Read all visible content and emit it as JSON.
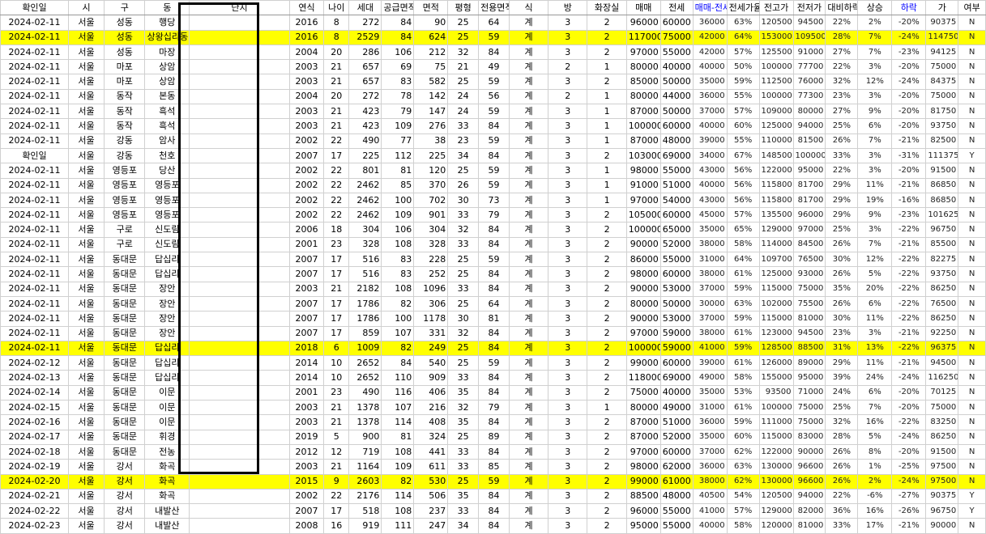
{
  "columns": [
    {
      "label": "확인일",
      "w": 80
    },
    {
      "label": "시",
      "w": 42
    },
    {
      "label": "구",
      "w": 48
    },
    {
      "label": "동",
      "w": 52
    },
    {
      "label": "단지",
      "w": 118
    },
    {
      "label": "연식",
      "w": 40
    },
    {
      "label": "나이",
      "w": 30
    },
    {
      "label": "세대",
      "w": 38
    },
    {
      "label": "공급면적",
      "w": 38
    },
    {
      "label": "면적",
      "w": 40
    },
    {
      "label": "평형",
      "w": 36
    },
    {
      "label": "전용면적",
      "w": 36
    },
    {
      "label": "식",
      "w": 46
    },
    {
      "label": "방",
      "w": 46
    },
    {
      "label": "화장실",
      "w": 46
    },
    {
      "label": "매매",
      "w": 40
    },
    {
      "label": "전세",
      "w": 38
    },
    {
      "label": "매매-전세",
      "w": 40,
      "blue": true
    },
    {
      "label": "전세가율",
      "w": 38
    },
    {
      "label": "전고가",
      "w": 40
    },
    {
      "label": "전저가",
      "w": 38
    },
    {
      "label": "대비하락",
      "w": 38
    },
    {
      "label": "상승",
      "w": 40
    },
    {
      "label": "하락",
      "w": 40,
      "blue": true
    },
    {
      "label": "가",
      "w": 38
    },
    {
      "label": "여부",
      "w": 32
    }
  ],
  "rows": [
    {
      "hl": false,
      "c": [
        "2024-02-11",
        "서울",
        "성동",
        "행당",
        "",
        "2016",
        "8",
        "272",
        "84",
        "90",
        "25",
        "64",
        "계",
        "3",
        "2",
        "96000",
        "60000",
        "36000",
        "63%",
        "120500",
        "94500",
        "22%",
        "2%",
        "-20%",
        "90375",
        "N"
      ]
    },
    {
      "hl": true,
      "c": [
        "2024-02-11",
        "서울",
        "성동",
        "상왕십리동",
        "",
        "2016",
        "8",
        "2529",
        "84",
        "624",
        "25",
        "59",
        "계",
        "3",
        "2",
        "117000",
        "75000",
        "42000",
        "64%",
        "153000",
        "109500",
        "28%",
        "7%",
        "-24%",
        "114750",
        "N"
      ]
    },
    {
      "hl": false,
      "c": [
        "2024-02-11",
        "서울",
        "성동",
        "마장",
        "",
        "2004",
        "20",
        "286",
        "106",
        "212",
        "32",
        "84",
        "계",
        "3",
        "2",
        "97000",
        "55000",
        "42000",
        "57%",
        "125500",
        "91000",
        "27%",
        "7%",
        "-23%",
        "94125",
        "N"
      ]
    },
    {
      "hl": false,
      "c": [
        "2024-02-11",
        "서울",
        "마포",
        "상암",
        "",
        "2003",
        "21",
        "657",
        "69",
        "75",
        "21",
        "49",
        "계",
        "2",
        "1",
        "80000",
        "40000",
        "40000",
        "50%",
        "100000",
        "77700",
        "22%",
        "3%",
        "-20%",
        "75000",
        "N"
      ]
    },
    {
      "hl": false,
      "c": [
        "2024-02-11",
        "서울",
        "마포",
        "상암",
        "",
        "2003",
        "21",
        "657",
        "83",
        "582",
        "25",
        "59",
        "계",
        "3",
        "2",
        "85000",
        "50000",
        "35000",
        "59%",
        "112500",
        "76000",
        "32%",
        "12%",
        "-24%",
        "84375",
        "N"
      ]
    },
    {
      "hl": false,
      "c": [
        "2024-02-11",
        "서울",
        "동작",
        "본동",
        "",
        "2004",
        "20",
        "272",
        "78",
        "142",
        "24",
        "56",
        "계",
        "2",
        "1",
        "80000",
        "44000",
        "36000",
        "55%",
        "100000",
        "77300",
        "23%",
        "3%",
        "-20%",
        "75000",
        "N"
      ]
    },
    {
      "hl": false,
      "c": [
        "2024-02-11",
        "서울",
        "동작",
        "흑석",
        "",
        "2003",
        "21",
        "423",
        "79",
        "147",
        "24",
        "59",
        "계",
        "3",
        "1",
        "87000",
        "50000",
        "37000",
        "57%",
        "109000",
        "80000",
        "27%",
        "9%",
        "-20%",
        "81750",
        "N"
      ]
    },
    {
      "hl": false,
      "c": [
        "2024-02-11",
        "서울",
        "동작",
        "흑석",
        "",
        "2003",
        "21",
        "423",
        "109",
        "276",
        "33",
        "84",
        "계",
        "3",
        "1",
        "100000",
        "60000",
        "40000",
        "60%",
        "125000",
        "94000",
        "25%",
        "6%",
        "-20%",
        "93750",
        "N"
      ]
    },
    {
      "hl": false,
      "c": [
        "2024-02-11",
        "서울",
        "강동",
        "암사",
        "",
        "2002",
        "22",
        "490",
        "77",
        "38",
        "23",
        "59",
        "계",
        "3",
        "1",
        "87000",
        "48000",
        "39000",
        "55%",
        "110000",
        "81500",
        "26%",
        "7%",
        "-21%",
        "82500",
        "N"
      ]
    },
    {
      "hl": false,
      "c": [
        "확인일",
        "서울",
        "강동",
        "천호",
        "",
        "2007",
        "17",
        "225",
        "112",
        "225",
        "34",
        "84",
        "계",
        "3",
        "2",
        "103000",
        "69000",
        "34000",
        "67%",
        "148500",
        "100000",
        "33%",
        "3%",
        "-31%",
        "111375",
        "Y"
      ]
    },
    {
      "hl": false,
      "c": [
        "2024-02-11",
        "서울",
        "영등포",
        "당산",
        "",
        "2002",
        "22",
        "801",
        "81",
        "120",
        "25",
        "59",
        "계",
        "3",
        "1",
        "98000",
        "55000",
        "43000",
        "56%",
        "122000",
        "95000",
        "22%",
        "3%",
        "-20%",
        "91500",
        "N"
      ]
    },
    {
      "hl": false,
      "c": [
        "2024-02-11",
        "서울",
        "영등포",
        "영등포",
        "",
        "2002",
        "22",
        "2462",
        "85",
        "370",
        "26",
        "59",
        "계",
        "3",
        "1",
        "91000",
        "51000",
        "40000",
        "56%",
        "115800",
        "81700",
        "29%",
        "11%",
        "-21%",
        "86850",
        "N"
      ]
    },
    {
      "hl": false,
      "c": [
        "2024-02-11",
        "서울",
        "영등포",
        "영등포",
        "",
        "2002",
        "22",
        "2462",
        "100",
        "702",
        "30",
        "73",
        "계",
        "3",
        "1",
        "97000",
        "54000",
        "43000",
        "56%",
        "115800",
        "81700",
        "29%",
        "19%",
        "-16%",
        "86850",
        "N"
      ]
    },
    {
      "hl": false,
      "c": [
        "2024-02-11",
        "서울",
        "영등포",
        "영등포",
        "",
        "2002",
        "22",
        "2462",
        "109",
        "901",
        "33",
        "79",
        "계",
        "3",
        "2",
        "105000",
        "60000",
        "45000",
        "57%",
        "135500",
        "96000",
        "29%",
        "9%",
        "-23%",
        "101625",
        "N"
      ]
    },
    {
      "hl": false,
      "c": [
        "2024-02-11",
        "서울",
        "구로",
        "신도림",
        "",
        "2006",
        "18",
        "304",
        "106",
        "304",
        "32",
        "84",
        "계",
        "3",
        "2",
        "100000",
        "65000",
        "35000",
        "65%",
        "129000",
        "97000",
        "25%",
        "3%",
        "-22%",
        "96750",
        "N"
      ]
    },
    {
      "hl": false,
      "c": [
        "2024-02-11",
        "서울",
        "구로",
        "신도림",
        "",
        "2001",
        "23",
        "328",
        "108",
        "328",
        "33",
        "84",
        "계",
        "3",
        "2",
        "90000",
        "52000",
        "38000",
        "58%",
        "114000",
        "84500",
        "26%",
        "7%",
        "-21%",
        "85500",
        "N"
      ]
    },
    {
      "hl": false,
      "c": [
        "2024-02-11",
        "서울",
        "동대문",
        "답십리",
        "",
        "2007",
        "17",
        "516",
        "83",
        "228",
        "25",
        "59",
        "계",
        "3",
        "2",
        "86000",
        "55000",
        "31000",
        "64%",
        "109700",
        "76500",
        "30%",
        "12%",
        "-22%",
        "82275",
        "N"
      ]
    },
    {
      "hl": false,
      "c": [
        "2024-02-11",
        "서울",
        "동대문",
        "답십리",
        "",
        "2007",
        "17",
        "516",
        "83",
        "252",
        "25",
        "84",
        "계",
        "3",
        "2",
        "98000",
        "60000",
        "38000",
        "61%",
        "125000",
        "93000",
        "26%",
        "5%",
        "-22%",
        "93750",
        "N"
      ]
    },
    {
      "hl": false,
      "c": [
        "2024-02-11",
        "서울",
        "동대문",
        "장안",
        "",
        "2003",
        "21",
        "2182",
        "108",
        "1096",
        "33",
        "84",
        "계",
        "3",
        "2",
        "90000",
        "53000",
        "37000",
        "59%",
        "115000",
        "75000",
        "35%",
        "20%",
        "-22%",
        "86250",
        "N"
      ]
    },
    {
      "hl": false,
      "c": [
        "2024-02-11",
        "서울",
        "동대문",
        "장안",
        "",
        "2007",
        "17",
        "1786",
        "82",
        "306",
        "25",
        "64",
        "계",
        "3",
        "2",
        "80000",
        "50000",
        "30000",
        "63%",
        "102000",
        "75500",
        "26%",
        "6%",
        "-22%",
        "76500",
        "N"
      ]
    },
    {
      "hl": false,
      "c": [
        "2024-02-11",
        "서울",
        "동대문",
        "장안",
        "",
        "2007",
        "17",
        "1786",
        "100",
        "1178",
        "30",
        "81",
        "계",
        "3",
        "2",
        "90000",
        "53000",
        "37000",
        "59%",
        "115000",
        "81000",
        "30%",
        "11%",
        "-22%",
        "86250",
        "N"
      ]
    },
    {
      "hl": false,
      "c": [
        "2024-02-11",
        "서울",
        "동대문",
        "장안",
        "",
        "2007",
        "17",
        "859",
        "107",
        "331",
        "32",
        "84",
        "계",
        "3",
        "2",
        "97000",
        "59000",
        "38000",
        "61%",
        "123000",
        "94500",
        "23%",
        "3%",
        "-21%",
        "92250",
        "N"
      ]
    },
    {
      "hl": true,
      "c": [
        "2024-02-11",
        "서울",
        "동대문",
        "답십리",
        "",
        "2018",
        "6",
        "1009",
        "82",
        "249",
        "25",
        "84",
        "계",
        "3",
        "2",
        "100000",
        "59000",
        "41000",
        "59%",
        "128500",
        "88500",
        "31%",
        "13%",
        "-22%",
        "96375",
        "N"
      ]
    },
    {
      "hl": false,
      "c": [
        "2024-02-12",
        "서울",
        "동대문",
        "답십리",
        "",
        "2014",
        "10",
        "2652",
        "84",
        "540",
        "25",
        "59",
        "계",
        "3",
        "2",
        "99000",
        "60000",
        "39000",
        "61%",
        "126000",
        "89000",
        "29%",
        "11%",
        "-21%",
        "94500",
        "N"
      ]
    },
    {
      "hl": false,
      "c": [
        "2024-02-13",
        "서울",
        "동대문",
        "답십리",
        "",
        "2014",
        "10",
        "2652",
        "110",
        "909",
        "33",
        "84",
        "계",
        "3",
        "2",
        "118000",
        "69000",
        "49000",
        "58%",
        "155000",
        "95000",
        "39%",
        "24%",
        "-24%",
        "116250",
        "N"
      ]
    },
    {
      "hl": false,
      "c": [
        "2024-02-14",
        "서울",
        "동대문",
        "이문",
        "",
        "2001",
        "23",
        "490",
        "116",
        "406",
        "35",
        "84",
        "계",
        "3",
        "2",
        "75000",
        "40000",
        "35000",
        "53%",
        "93500",
        "71000",
        "24%",
        "6%",
        "-20%",
        "70125",
        "N"
      ]
    },
    {
      "hl": false,
      "c": [
        "2024-02-15",
        "서울",
        "동대문",
        "이문",
        "",
        "2003",
        "21",
        "1378",
        "107",
        "216",
        "32",
        "79",
        "계",
        "3",
        "1",
        "80000",
        "49000",
        "31000",
        "61%",
        "100000",
        "75000",
        "25%",
        "7%",
        "-20%",
        "75000",
        "N"
      ]
    },
    {
      "hl": false,
      "c": [
        "2024-02-16",
        "서울",
        "동대문",
        "이문",
        "",
        "2003",
        "21",
        "1378",
        "114",
        "408",
        "35",
        "84",
        "계",
        "3",
        "2",
        "87000",
        "51000",
        "36000",
        "59%",
        "111000",
        "75000",
        "32%",
        "16%",
        "-22%",
        "83250",
        "N"
      ]
    },
    {
      "hl": false,
      "c": [
        "2024-02-17",
        "서울",
        "동대문",
        "휘경",
        "",
        "2019",
        "5",
        "900",
        "81",
        "324",
        "25",
        "89",
        "계",
        "3",
        "2",
        "87000",
        "52000",
        "35000",
        "60%",
        "115000",
        "83000",
        "28%",
        "5%",
        "-24%",
        "86250",
        "N"
      ]
    },
    {
      "hl": false,
      "c": [
        "2024-02-18",
        "서울",
        "동대문",
        "전농",
        "",
        "2012",
        "12",
        "719",
        "108",
        "441",
        "33",
        "84",
        "계",
        "3",
        "2",
        "97000",
        "60000",
        "37000",
        "62%",
        "122000",
        "90000",
        "26%",
        "8%",
        "-20%",
        "91500",
        "N"
      ]
    },
    {
      "hl": false,
      "c": [
        "2024-02-19",
        "서울",
        "강서",
        "화곡",
        "",
        "2003",
        "21",
        "1164",
        "109",
        "611",
        "33",
        "85",
        "계",
        "3",
        "2",
        "98000",
        "62000",
        "36000",
        "63%",
        "130000",
        "96600",
        "26%",
        "1%",
        "-25%",
        "97500",
        "N"
      ]
    },
    {
      "hl": true,
      "c": [
        "2024-02-20",
        "서울",
        "강서",
        "화곡",
        "",
        "2015",
        "9",
        "2603",
        "82",
        "530",
        "25",
        "59",
        "계",
        "3",
        "2",
        "99000",
        "61000",
        "38000",
        "62%",
        "130000",
        "96600",
        "26%",
        "2%",
        "-24%",
        "97500",
        "N"
      ]
    },
    {
      "hl": false,
      "c": [
        "2024-02-21",
        "서울",
        "강서",
        "화곡",
        "",
        "2002",
        "22",
        "2176",
        "114",
        "506",
        "35",
        "84",
        "계",
        "3",
        "2",
        "88500",
        "48000",
        "40500",
        "54%",
        "120500",
        "94000",
        "22%",
        "-6%",
        "-27%",
        "90375",
        "Y"
      ]
    },
    {
      "hl": false,
      "c": [
        "2024-02-22",
        "서울",
        "강서",
        "내발산",
        "",
        "2007",
        "17",
        "518",
        "108",
        "237",
        "33",
        "84",
        "계",
        "3",
        "2",
        "96000",
        "55000",
        "41000",
        "57%",
        "129000",
        "82000",
        "36%",
        "16%",
        "-26%",
        "96750",
        "Y"
      ]
    },
    {
      "hl": false,
      "c": [
        "2024-02-23",
        "서울",
        "강서",
        "내발산",
        "",
        "2008",
        "16",
        "919",
        "111",
        "247",
        "34",
        "84",
        "계",
        "3",
        "2",
        "95000",
        "55000",
        "40000",
        "58%",
        "120000",
        "81000",
        "33%",
        "17%",
        "-21%",
        "90000",
        "N"
      ]
    }
  ]
}
